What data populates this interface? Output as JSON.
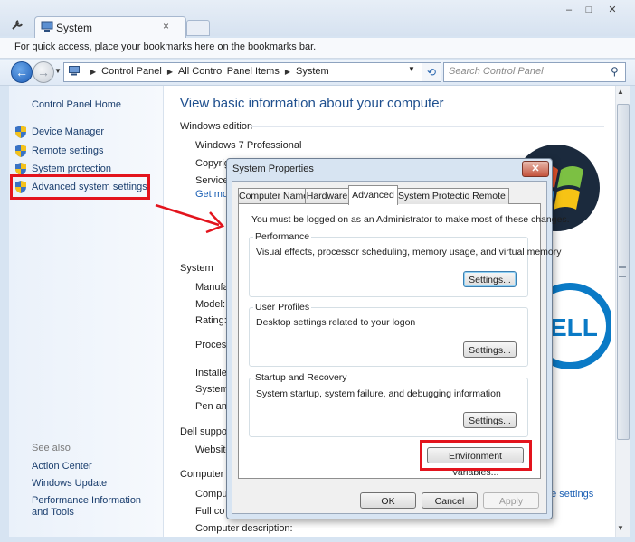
{
  "browser": {
    "tab_title": "System",
    "tab_close": "×",
    "bookmark_message": "For quick access, place your bookmarks here on the bookmarks bar.",
    "window_controls": [
      "–",
      "□",
      "✕"
    ]
  },
  "address": {
    "crumbs": [
      "Control Panel",
      "All Control Panel Items",
      "System"
    ],
    "search_placeholder": "Search Control Panel"
  },
  "sidebar": {
    "home": "Control Panel Home",
    "items": [
      {
        "label": "Device Manager",
        "icon": "shield-icon"
      },
      {
        "label": "Remote settings",
        "icon": "shield-icon"
      },
      {
        "label": "System protection",
        "icon": "shield-icon"
      },
      {
        "label": "Advanced system settings",
        "icon": "shield-icon"
      }
    ],
    "see_also": "See also",
    "see_also_items": [
      "Action Center",
      "Windows Update",
      "Performance Information and Tools"
    ]
  },
  "main": {
    "title": "View basic information about your computer",
    "windows_edition": {
      "heading": "Windows edition",
      "edition": "Windows 7 Professional",
      "copyright": "Copyrig",
      "service": "Service",
      "get_more": "Get mo"
    },
    "system": {
      "heading": "System",
      "labels": [
        "Manufa",
        "Model:",
        "Rating:",
        "Process",
        "Installed",
        "System",
        "Pen and"
      ]
    },
    "dell_support": {
      "heading": "Dell suppor",
      "website": "Website"
    },
    "computer": {
      "heading": "Computer n",
      "labels": [
        "Compu",
        "Full co",
        "Computer description:"
      ],
      "change_link": "ge settings"
    }
  },
  "dialog": {
    "title": "System Properties",
    "close": "✕",
    "tabs": [
      "Computer Name",
      "Hardware",
      "Advanced",
      "System Protection",
      "Remote"
    ],
    "active_tab": "Advanced",
    "admin_message": "You must be logged on as an Administrator to make most of these changes.",
    "performance": {
      "label": "Performance",
      "description": "Visual effects, processor scheduling, memory usage, and virtual memory",
      "button": "Settings..."
    },
    "user_profiles": {
      "label": "User Profiles",
      "description": "Desktop settings related to your logon",
      "button": "Settings..."
    },
    "startup": {
      "label": "Startup and Recovery",
      "description": "System startup, system failure, and debugging information",
      "button": "Settings..."
    },
    "env_button": "Environment Variables...",
    "ok": "OK",
    "cancel": "Cancel",
    "apply": "Apply"
  },
  "colors": {
    "highlight": "#e3141d",
    "link": "#1a3e6e",
    "title_blue": "#1e4f8e"
  }
}
